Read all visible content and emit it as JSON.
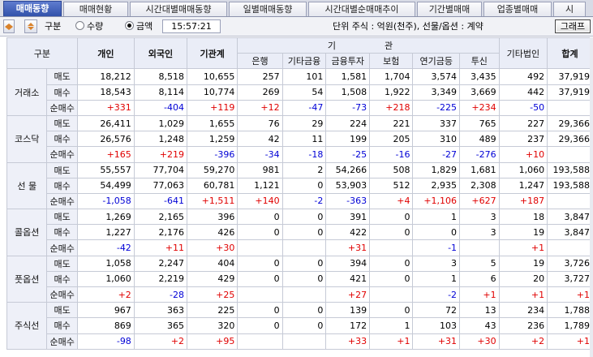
{
  "tabs": [
    "매매동향",
    "매매현황",
    "시간대별매매동향",
    "일별매매동향",
    "시간대별순매매추이",
    "기간별매매",
    "업종별매매",
    "시"
  ],
  "toolbar": {
    "gubun_label": "구분",
    "radio_qty": "수량",
    "radio_amount": "금액",
    "time": "15:57:21",
    "unit_text": "단위 주식 : 억원(천주), 선물/옵션 : 계약",
    "graph_button": "그래프"
  },
  "header": {
    "gubun": "구분",
    "individual": "개인",
    "foreign": "외국인",
    "institution_total": "기관계",
    "inst_group_1": "기",
    "inst_group_2": "관",
    "bank": "은행",
    "other_finance": "기타금융",
    "fin_invest": "금융투자",
    "insurance": "보험",
    "pension": "연기금등",
    "trust": "투신",
    "other_corp": "기타법인",
    "total": "합계"
  },
  "row_labels": {
    "sell": "매도",
    "buy": "매수",
    "net": "순매수"
  },
  "groups": [
    {
      "name": "거래소",
      "sell": [
        "18,212",
        "8,518",
        "10,655",
        "257",
        "101",
        "1,581",
        "1,704",
        "3,574",
        "3,435",
        "492",
        "37,919"
      ],
      "buy": [
        "18,543",
        "8,114",
        "10,774",
        "269",
        "54",
        "1,508",
        "1,922",
        "3,349",
        "3,669",
        "442",
        "37,919"
      ],
      "net": [
        "+331",
        "-404",
        "+119",
        "+12",
        "-47",
        "-73",
        "+218",
        "-225",
        "+234",
        "-50",
        ""
      ]
    },
    {
      "name": "코스닥",
      "sell": [
        "26,411",
        "1,029",
        "1,655",
        "76",
        "29",
        "224",
        "221",
        "337",
        "765",
        "227",
        "29,366"
      ],
      "buy": [
        "26,576",
        "1,248",
        "1,259",
        "42",
        "11",
        "199",
        "205",
        "310",
        "489",
        "237",
        "29,366"
      ],
      "net": [
        "+165",
        "+219",
        "-396",
        "-34",
        "-18",
        "-25",
        "-16",
        "-27",
        "-276",
        "+10",
        ""
      ]
    },
    {
      "name": "선    물",
      "sell": [
        "55,557",
        "77,704",
        "59,270",
        "981",
        "2",
        "54,266",
        "508",
        "1,829",
        "1,681",
        "1,060",
        "193,588"
      ],
      "buy": [
        "54,499",
        "77,063",
        "60,781",
        "1,121",
        "0",
        "53,903",
        "512",
        "2,935",
        "2,308",
        "1,247",
        "193,588"
      ],
      "net": [
        "-1,058",
        "-641",
        "+1,511",
        "+140",
        "-2",
        "-363",
        "+4",
        "+1,106",
        "+627",
        "+187",
        ""
      ]
    },
    {
      "name": "콜옵션",
      "sell": [
        "1,269",
        "2,165",
        "396",
        "0",
        "0",
        "391",
        "0",
        "1",
        "3",
        "18",
        "3,847"
      ],
      "buy": [
        "1,227",
        "2,176",
        "426",
        "0",
        "0",
        "422",
        "0",
        "0",
        "3",
        "19",
        "3,847"
      ],
      "net": [
        "-42",
        "+11",
        "+30",
        "",
        "",
        "+31",
        "",
        "-1",
        "",
        "+1",
        ""
      ]
    },
    {
      "name": "풋옵션",
      "sell": [
        "1,058",
        "2,247",
        "404",
        "0",
        "0",
        "394",
        "0",
        "3",
        "5",
        "19",
        "3,726"
      ],
      "buy": [
        "1,060",
        "2,219",
        "429",
        "0",
        "0",
        "421",
        "0",
        "1",
        "6",
        "20",
        "3,727"
      ],
      "net": [
        "+2",
        "-28",
        "+25",
        "",
        "",
        "+27",
        "",
        "-2",
        "+1",
        "+1",
        "+1"
      ]
    },
    {
      "name": "주식선",
      "sell": [
        "967",
        "363",
        "225",
        "0",
        "0",
        "139",
        "0",
        "72",
        "13",
        "234",
        "1,788"
      ],
      "buy": [
        "869",
        "365",
        "320",
        "0",
        "0",
        "172",
        "1",
        "103",
        "43",
        "236",
        "1,789"
      ],
      "net": [
        "-98",
        "+2",
        "+95",
        "",
        "",
        "+33",
        "+1",
        "+31",
        "+30",
        "+2",
        "+1"
      ]
    }
  ],
  "colors": {
    "positive": "#e00000",
    "negative": "#0000d6",
    "active_tab": "#3355b0",
    "header_bg": "#eaedf7"
  }
}
